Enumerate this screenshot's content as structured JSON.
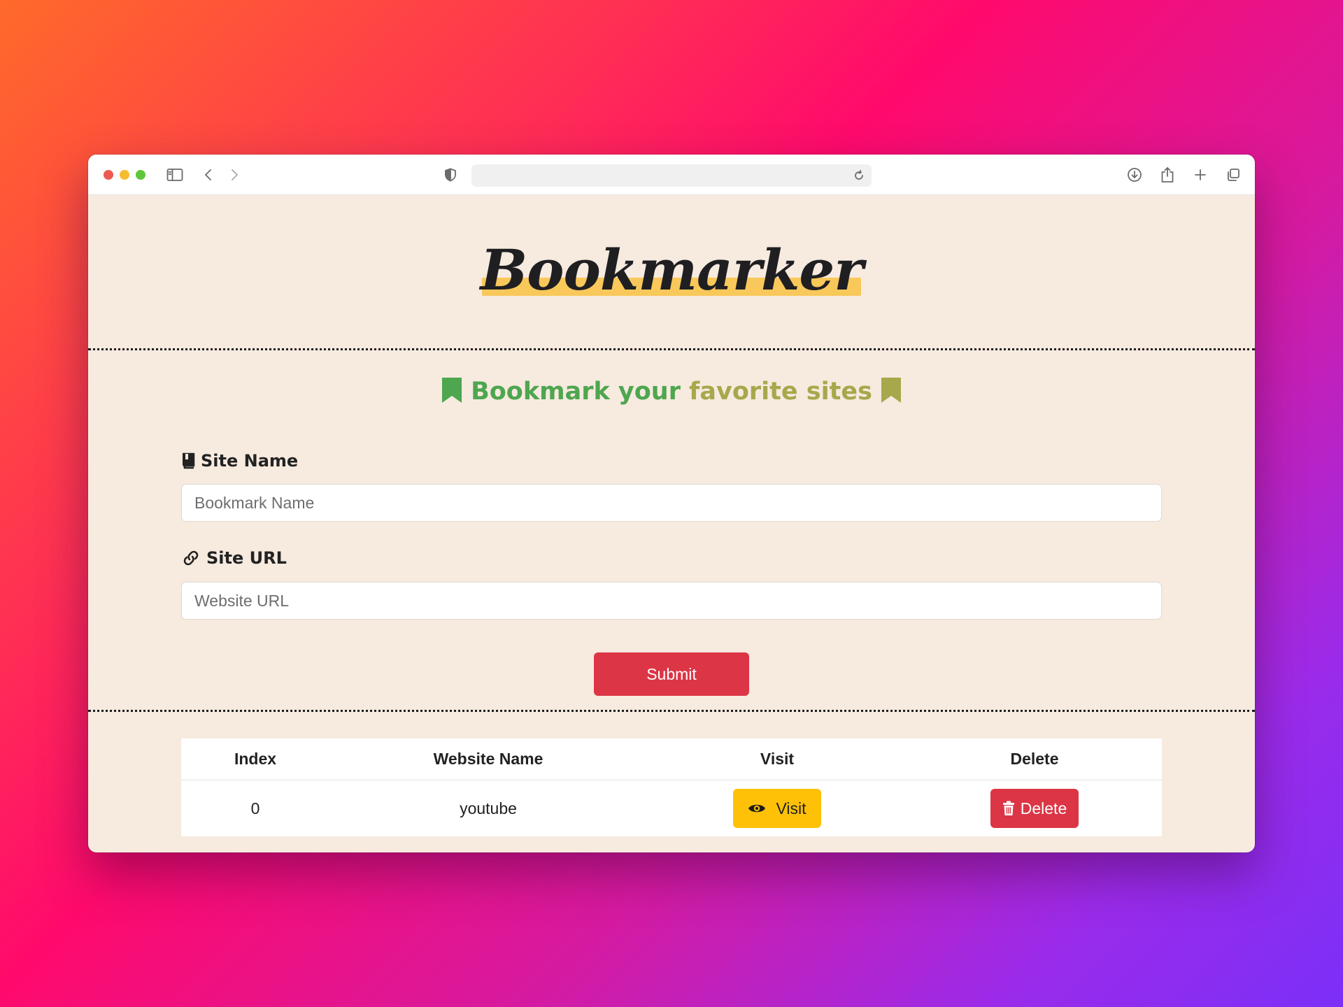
{
  "browser": {
    "address": ""
  },
  "header": {
    "brand": "Bookmarker"
  },
  "form": {
    "title_main": "Bookmark your",
    "title_tail": "favorite sites",
    "site_name_label": "Site Name",
    "site_name_placeholder": "Bookmark Name",
    "site_url_label": "Site URL",
    "site_url_placeholder": "Website URL",
    "submit_label": "Submit"
  },
  "table": {
    "headers": [
      "Index",
      "Website Name",
      "Visit",
      "Delete"
    ],
    "rows": [
      {
        "index": "0",
        "name": "youtube",
        "visit_label": "Visit",
        "delete_label": "Delete"
      }
    ]
  },
  "colors": {
    "accent_red": "#dc3545",
    "accent_yellow": "#ffc107",
    "title_green": "#4ea64f",
    "title_olive": "#a7a84b",
    "page_bg": "#f7eadf"
  }
}
